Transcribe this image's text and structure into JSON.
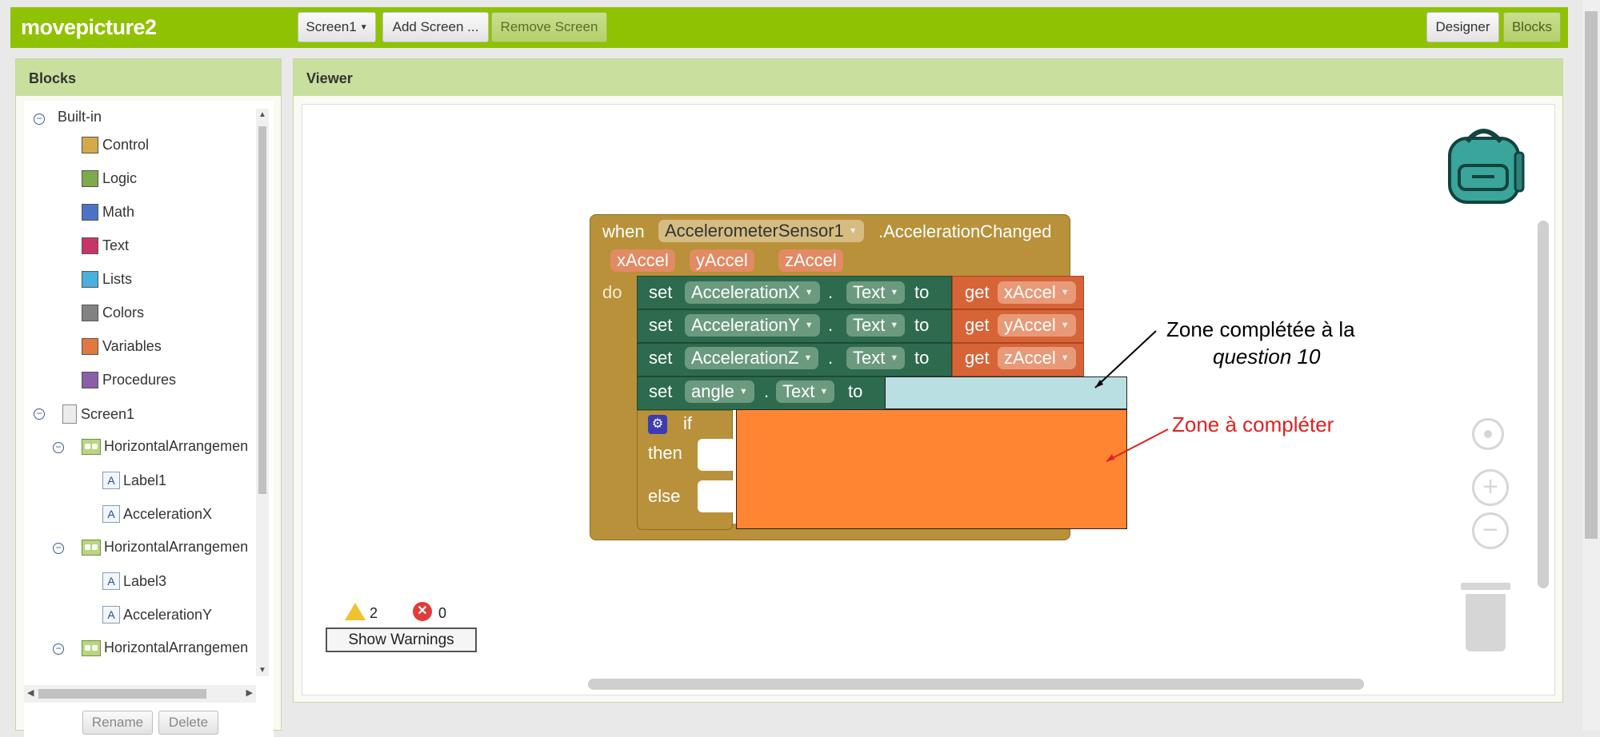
{
  "header": {
    "app_title": "movepicture2",
    "screen_dropdown": "Screen1",
    "add_screen": "Add Screen ...",
    "remove_screen": "Remove Screen",
    "designer": "Designer",
    "blocks": "Blocks"
  },
  "blocks_panel": {
    "title": "Blocks",
    "builtin_label": "Built-in",
    "builtin": [
      {
        "label": "Control",
        "color": "#d3a94a"
      },
      {
        "label": "Logic",
        "color": "#7daa4a"
      },
      {
        "label": "Math",
        "color": "#4a73c5"
      },
      {
        "label": "Text",
        "color": "#c93468"
      },
      {
        "label": "Lists",
        "color": "#4ab0de"
      },
      {
        "label": "Colors",
        "color": "#828282"
      },
      {
        "label": "Variables",
        "color": "#e07840"
      },
      {
        "label": "Procedures",
        "color": "#8a5ea8"
      }
    ],
    "screen_label": "Screen1",
    "components": [
      {
        "label": "HorizontalArrangemen",
        "children": [
          "Label1",
          "AccelerationX"
        ]
      },
      {
        "label": "HorizontalArrangemen",
        "children": [
          "Label3",
          "AccelerationY"
        ]
      },
      {
        "label": "HorizontalArrangemen",
        "children": []
      }
    ],
    "rename": "Rename",
    "delete": "Delete"
  },
  "viewer": {
    "title": "Viewer",
    "warnings_count": "2",
    "errors_count": "0",
    "show_warnings": "Show Warnings"
  },
  "event_block": {
    "when": "when",
    "component": "AccelerometerSensor1",
    "event": ".AccelerationChanged",
    "params": [
      "xAccel",
      "yAccel",
      "zAccel"
    ],
    "do": "do",
    "rows": [
      {
        "set": "set",
        "component": "AccelerationX",
        "prop": "Text",
        "to": "to",
        "get": "get",
        "var": "xAccel"
      },
      {
        "set": "set",
        "component": "AccelerationY",
        "prop": "Text",
        "to": "to",
        "get": "get",
        "var": "yAccel"
      },
      {
        "set": "set",
        "component": "AccelerationZ",
        "prop": "Text",
        "to": "to",
        "get": "get",
        "var": "zAccel"
      }
    ],
    "angle_row": {
      "set": "set",
      "component": "angle",
      "dot": ".",
      "prop": "Text",
      "to": "to"
    },
    "if": "if",
    "then": "then",
    "else": "else"
  },
  "annotations": {
    "completed_line1": "Zone complétée à la",
    "completed_line2": "question 10",
    "to_complete": "Zone à compléter",
    "completed_color": "#b9dfe3",
    "to_complete_color": "#ff8533"
  },
  "colors": {
    "topbar": "#8fc202",
    "event_block": "#b8913a",
    "set_block": "#2e6a4e",
    "get_block": "#d76437"
  }
}
